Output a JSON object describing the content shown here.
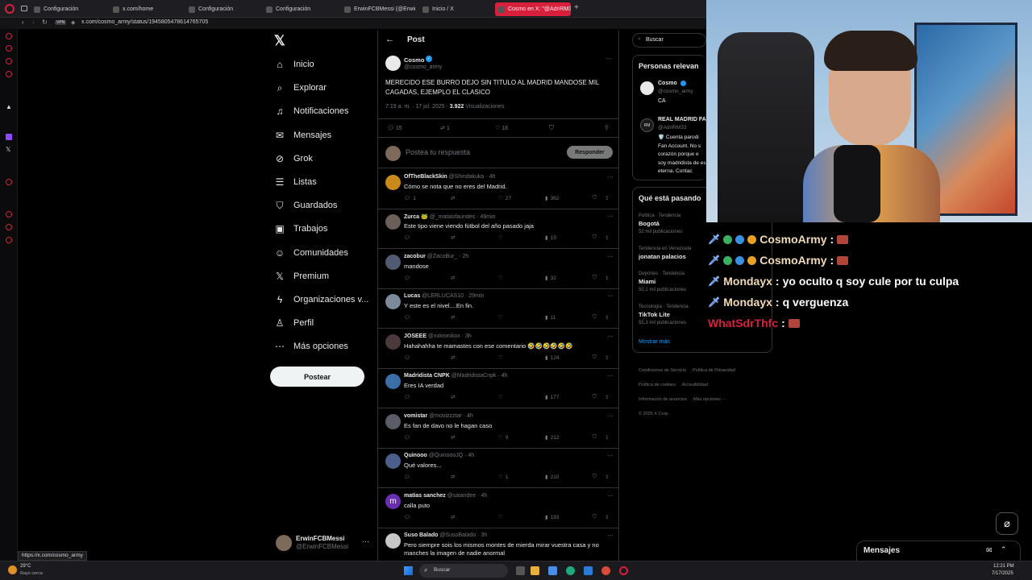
{
  "browser": {
    "tabs": [
      {
        "label": "Configuración",
        "active": false
      },
      {
        "label": "x.com/home",
        "active": false
      },
      {
        "label": "Configuración",
        "active": false
      },
      {
        "label": "Configuración",
        "active": false
      },
      {
        "label": "ErwinFCBMessi (@ErwinF",
        "active": false
      },
      {
        "label": "Inicio / X",
        "active": false
      },
      {
        "label": "Cosmo en X: \"@AdriRM3",
        "active": true
      }
    ],
    "url": "x.com/cosmo_army/status/1945805478614765705",
    "vpn_badge": "VPN",
    "status_link": "https://x.com/cosmo_army"
  },
  "nav": {
    "items": [
      {
        "label": "Inicio",
        "icon": "home-icon"
      },
      {
        "label": "Explorar",
        "icon": "search-icon"
      },
      {
        "label": "Notificaciones",
        "icon": "bell-icon"
      },
      {
        "label": "Mensajes",
        "icon": "mail-icon"
      },
      {
        "label": "Grok",
        "icon": "grok-icon"
      },
      {
        "label": "Listas",
        "icon": "list-icon"
      },
      {
        "label": "Guardados",
        "icon": "bookmark-icon"
      },
      {
        "label": "Trabajos",
        "icon": "briefcase-icon"
      },
      {
        "label": "Comunidades",
        "icon": "people-icon"
      },
      {
        "label": "Premium",
        "icon": "x-logo-icon"
      },
      {
        "label": "Organizaciones v...",
        "icon": "lightning-icon"
      },
      {
        "label": "Perfil",
        "icon": "person-icon"
      },
      {
        "label": "Más opciones",
        "icon": "more-circle-icon"
      }
    ],
    "post_button": "Postear",
    "account": {
      "name": "ErwinFCBMessi",
      "handle": "@ErwinFCBMessi"
    }
  },
  "post": {
    "header_title": "Post",
    "author_name": "Cosmo",
    "author_handle": "@cosmo_army",
    "text": "MERECIDO ESE BURRO DEJO SIN TITULO AL MADRID MANDOSE MIL CAGADAS, EJEMPLO EL CLASICO",
    "time": "7:19 a. m. · 17 jul. 2025 ·",
    "views_count": "3.922",
    "views_label": "Visualizaciones",
    "replies": "15",
    "reposts": "1",
    "likes": "18",
    "reply_placeholder": "Postea tu respuesta",
    "reply_button": "Responder"
  },
  "replies": [
    {
      "name": "OfTheBlackSkin",
      "handle": "@Shindakuka",
      "time": "4h",
      "text": "Cómo se nota que no eres del Madrid.",
      "replies": "1",
      "reposts": "",
      "likes": "27",
      "views": "362",
      "avatar": "#c88a1a"
    },
    {
      "name": "Zurca 🐸",
      "handle": "@_matiasfaundes",
      "time": "49min",
      "text": "Este tipo viene viendo fútbol del año pasado jaja",
      "replies": "",
      "reposts": "",
      "likes": "",
      "views": "15",
      "avatar": "#6b5f5a"
    },
    {
      "name": "zacobur",
      "handle": "@ZacoBur_",
      "time": "2h",
      "text": "mandose",
      "replies": "",
      "reposts": "",
      "likes": "",
      "views": "32",
      "avatar": "#505a70"
    },
    {
      "name": "Lucas",
      "handle": "@LERLUCAS10",
      "time": "29min",
      "text": "Y este es el nivel....En fin.",
      "replies": "",
      "reposts": "",
      "likes": "",
      "views": "11",
      "avatar": "#7c8a9c"
    },
    {
      "name": "JOSEEE",
      "handle": "@xxkronikxx",
      "time": "3h",
      "text": "Hahahahha te mamastes con ese comentario 🤣🤣🤣🤣🤣🤣",
      "replies": "",
      "reposts": "",
      "likes": "",
      "views": "124",
      "avatar": "#4a3a3a"
    },
    {
      "name": "Madridista CNPK",
      "handle": "@MadridistaCnpk",
      "time": "4h",
      "text": "Eres IA verdad",
      "replies": "",
      "reposts": "",
      "likes": "",
      "views": "177",
      "avatar": "#3a6fa8"
    },
    {
      "name": "vomistar",
      "handle": "@movizzztar",
      "time": "4h",
      "text": "Es fan de davo no le hagan caso",
      "replies": "",
      "reposts": "",
      "likes": "9",
      "views": "212",
      "avatar": "#5b5d66"
    },
    {
      "name": "Quinooo",
      "handle": "@QuinoooJQ",
      "time": "4h",
      "text": "Qué valores...",
      "replies": "",
      "reposts": "",
      "likes": "1",
      "views": "210",
      "avatar": "#4a5f8a"
    },
    {
      "name": "matias sanchez",
      "handle": "@saiandee",
      "time": "4h",
      "text": "calla puto",
      "replies": "",
      "reposts": "",
      "likes": "",
      "views": "193",
      "avatar": "#6a2fb0",
      "initial": "m"
    },
    {
      "name": "Suso Balado",
      "handle": "@SusoBalado",
      "time": "3h",
      "text": "Pero siempre sois los mismos montes de mierda mirar vuestra casa y no manches la imagen de nadie anormal",
      "replies": "",
      "reposts": "",
      "likes": "",
      "views": "",
      "avatar": "#c8c8c8"
    }
  ],
  "right": {
    "search_placeholder": "Buscar",
    "relevant_title": "Personas relevan",
    "people": [
      {
        "name": "Cosmo",
        "handle": "@cosmo_army",
        "bio": "CA"
      },
      {
        "name": "REAL MADRID FA",
        "handle": "@AdriRM33",
        "bio": "🛡️ Cuenta parodi Fan Account. No s corazón porque e soy madridista de es eterna. Contac"
      }
    ],
    "trending_title": "Qué está pasando",
    "trends": [
      {
        "category": "Política · Tendencia",
        "name": "Bogotá",
        "count": "52 mil publicaciones"
      },
      {
        "category": "Tendencia en Venezuela",
        "name": "jonatan palacios",
        "count": ""
      },
      {
        "category": "Deportes · Tendencia",
        "name": "Miami",
        "count": "50,1 mil publicaciones"
      },
      {
        "category": "Tecnología · Tendencia",
        "name": "TikTok Lite",
        "count": "55,3 mil publicaciones"
      }
    ],
    "show_more": "Mostrar más",
    "footer": [
      "Condiciones de Servicio",
      "Política de Privacidad",
      "Política de cookies",
      "Accesibilidad",
      "Información de anuncios",
      "Más opciones ···",
      "© 2025 X Corp."
    ],
    "messages_label": "Mensajes"
  },
  "chat": [
    {
      "user": "CosmoArmy",
      "message": "",
      "color": "#f0d9b5"
    },
    {
      "user": "CosmoArmy",
      "message": "",
      "color": "#f0d9b5"
    },
    {
      "user": "Mondayx",
      "message": "yo oculto q soy cule por tu culpa",
      "color": "#f0d9b5"
    },
    {
      "user": "Mondayx",
      "message": "q verguenza",
      "color": "#f0d9b5"
    },
    {
      "user": "WhatSdrThfc",
      "message": "",
      "color": "#d6203c"
    }
  ],
  "taskbar": {
    "weather_temp": "29°C",
    "weather_desc": "Rayo cerca",
    "search_label": "Buscar",
    "time": "12:21 PM",
    "date": "7/17/2025"
  },
  "colors": {
    "accent": "#1d9bf0",
    "brand_red": "#d6203c"
  }
}
